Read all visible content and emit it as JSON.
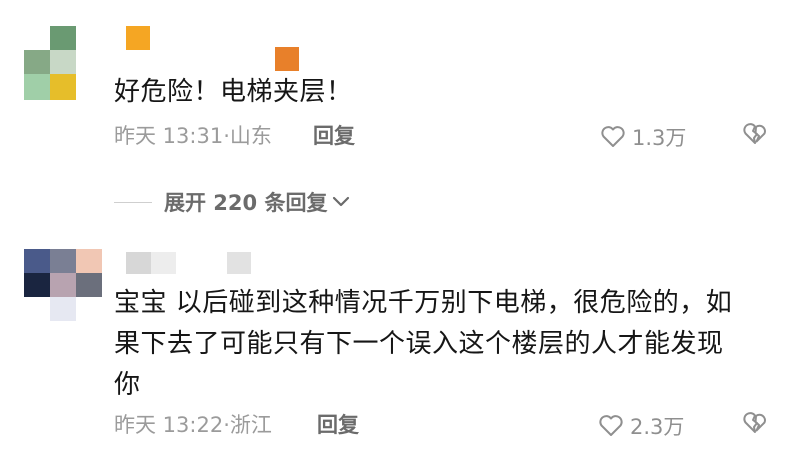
{
  "comments": [
    {
      "text": "好危险！电梯夹层！",
      "time": "昨天 13:31·山东",
      "reply_label": "回复",
      "likes": "1.3万",
      "avatar_colors": [
        "#6a9a72",
        "#86a986",
        "#a0cfa8",
        "#e6be2a"
      ],
      "name_colors": [
        "#f5a623",
        "#e8802a"
      ]
    },
    {
      "mention": "宝宝",
      "text_lines": [
        "以后碰到这种情况千万别下电梯，很危险的，如",
        "果下去了可能只有下一个误入这个楼层的人才能发现",
        "你"
      ],
      "time": "昨天 13:22·浙江",
      "reply_label": "回复",
      "likes": "2.3万",
      "avatar_colors": [
        "#4a5a8a",
        "#7a7f94",
        "#f1c7b4",
        "#1a2540",
        "#b8a3b0",
        "#6b6f7c",
        "#e6e8f2"
      ],
      "name_colors": [
        "#d7d7d7",
        "#e2e2e2"
      ]
    }
  ],
  "expand_label": "展开 220 条回复",
  "colors": {
    "meta": "#9b9b9b",
    "action": "#6b6b6b",
    "text": "#161616"
  }
}
